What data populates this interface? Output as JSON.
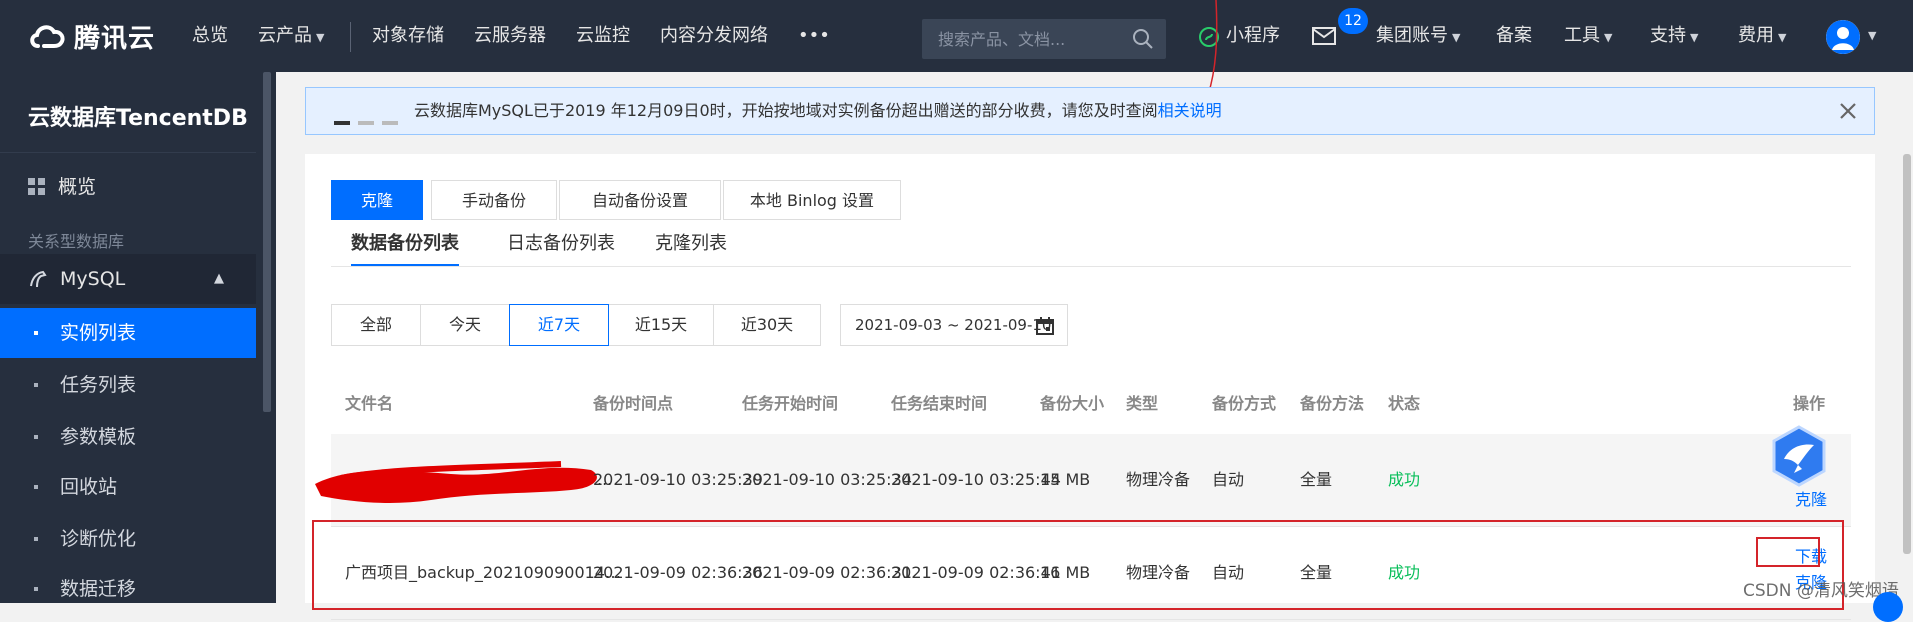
{
  "topnav": {
    "brand": "腾讯云",
    "items": [
      {
        "label": "总览"
      },
      {
        "label": "云产品"
      },
      {
        "label": "对象存储"
      },
      {
        "label": "云服务器"
      },
      {
        "label": "云监控"
      },
      {
        "label": "内容分发网络"
      },
      {
        "label": "•••"
      }
    ],
    "search_placeholder": "搜索产品、文档...",
    "mini_program": "小程序",
    "mail_count": "12",
    "right_items": [
      {
        "label": "集团账号"
      },
      {
        "label": "备案"
      },
      {
        "label": "工具"
      },
      {
        "label": "支持"
      },
      {
        "label": "费用"
      }
    ]
  },
  "sidebar": {
    "title": "云数据库TencentDB",
    "overview": "概览",
    "section": "关系型数据库",
    "group": "MySQL",
    "items": [
      {
        "label": "实例列表",
        "active": true
      },
      {
        "label": "任务列表"
      },
      {
        "label": "参数模板"
      },
      {
        "label": "回收站"
      },
      {
        "label": "诊断优化"
      },
      {
        "label": "数据迁移"
      }
    ]
  },
  "notice": {
    "text": "云数据库MySQL已于2019 年12月09日0时，开始按地域对实例备份超出赠送的部分收费，请您及时查阅",
    "link": "相关说明"
  },
  "actions": {
    "clone": "克隆",
    "manual_backup": "手动备份",
    "auto_backup_settings": "自动备份设置",
    "local_binlog_settings": "本地 Binlog 设置"
  },
  "tabs": [
    {
      "label": "数据备份列表",
      "active": true
    },
    {
      "label": "日志备份列表"
    },
    {
      "label": "克隆列表"
    }
  ],
  "filters": {
    "ranges": [
      {
        "label": "全部"
      },
      {
        "label": "今天"
      },
      {
        "label": "近7天",
        "active": true
      },
      {
        "label": "近15天"
      },
      {
        "label": "近30天"
      }
    ],
    "date_range": "2021-09-03 ~ 2021-09-10"
  },
  "table": {
    "headers": [
      "文件名",
      "备份时间点",
      "任务开始时间",
      "任务结束时间",
      "备份大小",
      "类型",
      "备份方式",
      "备份方法",
      "状态",
      "操作"
    ],
    "rows": [
      {
        "file": "...",
        "backup_time": "2021-09-10 03:25:39",
        "start": "2021-09-10 03:25:34",
        "end": "2021-09-10 03:25:44",
        "size": "15 MB",
        "type": "物理冷备",
        "mode": "自动",
        "method": "全量",
        "status": "成功",
        "ops": [
          "克隆"
        ]
      },
      {
        "file": "广西项目_backup_2021090900141...",
        "backup_time": "2021-09-09 02:36:36",
        "start": "2021-09-09 02:36:31",
        "end": "2021-09-09 02:36:41",
        "size": "16 MB",
        "type": "物理冷备",
        "mode": "自动",
        "method": "全量",
        "status": "成功",
        "ops": [
          "下载",
          "克隆"
        ]
      }
    ]
  },
  "watermark": "CSDN @清风笑烟语",
  "colors": {
    "nav_bg": "#262f3e",
    "primary": "#006eff",
    "success": "#0abf5b",
    "annotation_red": "#d4242a"
  }
}
